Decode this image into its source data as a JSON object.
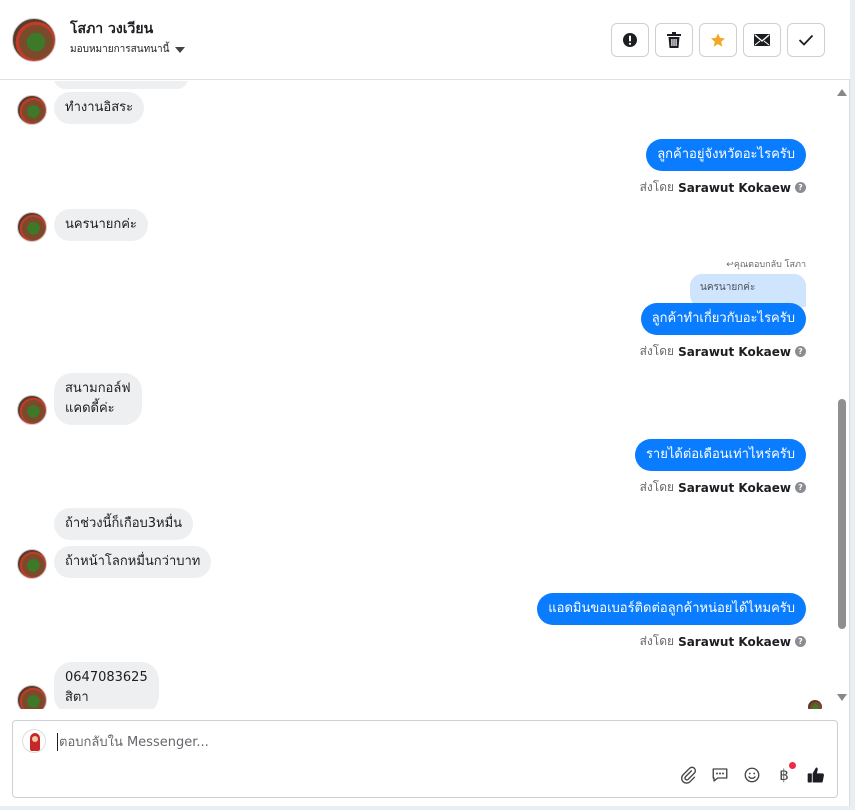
{
  "header": {
    "contact_name": "โสภา วงเวียน",
    "assign_label": "มอบหมายการสนทนานี้",
    "actions": [
      {
        "name": "spam-button",
        "icon": "exclamation-icon"
      },
      {
        "name": "delete-button",
        "icon": "trash-icon"
      },
      {
        "name": "star-button",
        "icon": "star-icon",
        "color": "#f5a623"
      },
      {
        "name": "mark-unread-button",
        "icon": "envelope-icon"
      },
      {
        "name": "done-button",
        "icon": "check-icon"
      }
    ]
  },
  "messages": {
    "m1": "ทำงานอิสระ",
    "m2": "ลูกค้าอยู่จังหวัดอะไรครับ",
    "m3": "นครนายกค่ะ",
    "m4_reply_note": "คุณตอบกลับ โสภา",
    "m4_quote": "นครนายกค่ะ",
    "m4": "ลูกค้าทำเกี่ยวกับอะไรครับ",
    "m5": "สนามกอล์ฟ\nแคดดี้ค่ะ",
    "m6": "รายได้ต่อเดือนเท่าไหร่ครับ",
    "m7a": "ถ้าช่วงนี้ก็เกือบ3หมื่น",
    "m7b": "ถ้าหน้าโลกหมื่นกว่าบาท",
    "m8": "แอดมินขอเบอร์ติดต่อลูกค้าหน่อยได้ไหมครับ",
    "m9": "0647083625\nสิตา"
  },
  "sent_by": {
    "prefix": "ส่งโดย",
    "agent": "Sarawut Kokaew",
    "help": "?"
  },
  "composer": {
    "placeholder": "ตอบกลับใน Messenger...",
    "value": "",
    "currency_symbol": "฿"
  },
  "colors": {
    "outgoing": "#0a7cff",
    "incoming": "#eeeff1",
    "accent_star": "#f5a623"
  }
}
